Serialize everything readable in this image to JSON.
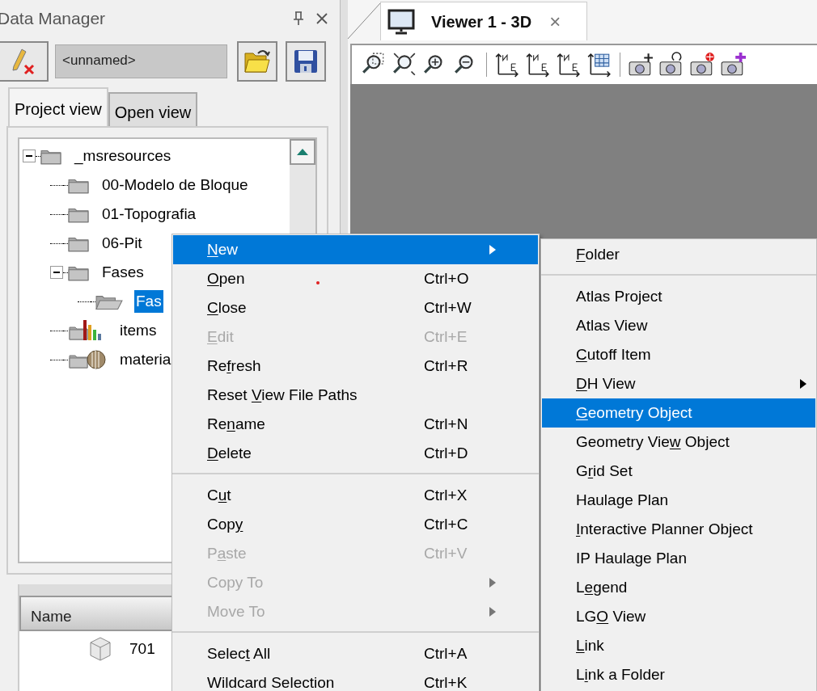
{
  "panel": {
    "title": "Data Manager",
    "project_field": {
      "value": "<unnamed>"
    },
    "tabs": [
      {
        "label": "Project view",
        "selected": true
      },
      {
        "label": "Open view",
        "selected": false
      }
    ],
    "tree": [
      {
        "label": "_msresources",
        "kind": "folder",
        "expanded": true,
        "selected": false,
        "children": [
          {
            "label": "00-Modelo de Bloque",
            "kind": "folder",
            "selected": false
          },
          {
            "label": "01-Topografia",
            "kind": "folder",
            "selected": false
          },
          {
            "label": "06-Pit",
            "kind": "folder",
            "selected": false
          },
          {
            "label": "Fases",
            "kind": "folder",
            "expanded": true,
            "selected": false,
            "children": [
              {
                "label": "Fas",
                "kind": "open",
                "selected": true
              }
            ]
          },
          {
            "label": "items",
            "kind": "chart",
            "selected": false
          },
          {
            "label": "materia",
            "kind": "material",
            "selected": false
          }
        ]
      }
    ],
    "list": {
      "columns": [
        "Name"
      ],
      "rows": [
        {
          "name": "701"
        }
      ]
    }
  },
  "viewer": {
    "tab": {
      "label": "Viewer 1 - 3D",
      "close": "×"
    }
  },
  "context_menu": {
    "groups": [
      [
        {
          "parts": [
            {
              "text": "N",
              "underline": true
            },
            {
              "text": "ew",
              "underline": false
            }
          ],
          "submenu": true,
          "disabled": false,
          "selected": true
        },
        {
          "parts": [
            {
              "text": "O",
              "underline": true
            },
            {
              "text": "pen",
              "underline": false
            }
          ],
          "shortcut": "Ctrl+O",
          "submenu": false,
          "disabled": false,
          "selected": false
        },
        {
          "parts": [
            {
              "text": "C",
              "underline": true
            },
            {
              "text": "lose",
              "underline": false
            }
          ],
          "shortcut": "Ctrl+W",
          "submenu": false,
          "disabled": false,
          "selected": false
        },
        {
          "parts": [
            {
              "text": "E",
              "underline": true
            },
            {
              "text": "dit",
              "underline": false
            }
          ],
          "shortcut": "Ctrl+E",
          "submenu": false,
          "disabled": true,
          "selected": false
        },
        {
          "parts": [
            {
              "text": "Re",
              "underline": false
            },
            {
              "text": "f",
              "underline": true
            },
            {
              "text": "resh",
              "underline": false
            }
          ],
          "shortcut": "Ctrl+R",
          "submenu": false,
          "disabled": false,
          "selected": false
        },
        {
          "parts": [
            {
              "text": "Reset ",
              "underline": false
            },
            {
              "text": "V",
              "underline": true
            },
            {
              "text": "iew File Paths",
              "underline": false
            }
          ],
          "submenu": false,
          "disabled": false,
          "selected": false
        },
        {
          "parts": [
            {
              "text": "Re",
              "underline": false
            },
            {
              "text": "n",
              "underline": true
            },
            {
              "text": "ame",
              "underline": false
            }
          ],
          "shortcut": "Ctrl+N",
          "submenu": false,
          "disabled": false,
          "selected": false
        },
        {
          "parts": [
            {
              "text": "D",
              "underline": true
            },
            {
              "text": "elete",
              "underline": false
            }
          ],
          "shortcut": "Ctrl+D",
          "submenu": false,
          "disabled": false,
          "selected": false
        }
      ],
      [
        {
          "parts": [
            {
              "text": "C",
              "underline": false
            },
            {
              "text": "u",
              "underline": true
            },
            {
              "text": "t",
              "underline": false
            }
          ],
          "shortcut": "Ctrl+X",
          "submenu": false,
          "disabled": false,
          "selected": false
        },
        {
          "parts": [
            {
              "text": "Cop",
              "underline": false
            },
            {
              "text": "y",
              "underline": true
            }
          ],
          "shortcut": "Ctrl+C",
          "submenu": false,
          "disabled": false,
          "selected": false
        },
        {
          "parts": [
            {
              "text": "P",
              "underline": false
            },
            {
              "text": "a",
              "underline": true
            },
            {
              "text": "ste",
              "underline": false
            }
          ],
          "shortcut": "Ctrl+V",
          "submenu": false,
          "disabled": true,
          "selected": false
        },
        {
          "parts": [
            {
              "text": "Copy To",
              "underline": false
            }
          ],
          "submenu": true,
          "disabled": true,
          "selected": false
        },
        {
          "parts": [
            {
              "text": "Move To",
              "underline": false
            }
          ],
          "submenu": true,
          "disabled": true,
          "selected": false
        }
      ],
      [
        {
          "parts": [
            {
              "text": "Selec",
              "underline": false
            },
            {
              "text": "t",
              "underline": true
            },
            {
              "text": " All",
              "underline": false
            }
          ],
          "shortcut": "Ctrl+A",
          "submenu": false,
          "disabled": false,
          "selected": false
        },
        {
          "parts": [
            {
              "text": "Wildcard Selection",
              "underline": false
            }
          ],
          "shortcut": "Ctrl+K",
          "submenu": false,
          "disabled": false,
          "selected": false
        }
      ]
    ]
  },
  "submenu": {
    "groups": [
      [
        {
          "parts": [
            {
              "text": "F",
              "underline": true
            },
            {
              "text": "older",
              "underline": false
            }
          ],
          "submenu": false,
          "disabled": false,
          "selected": false
        }
      ],
      [
        {
          "parts": [
            {
              "text": "Atlas Project",
              "underline": false
            }
          ],
          "submenu": false,
          "disabled": false,
          "selected": false
        },
        {
          "parts": [
            {
              "text": "Atlas View",
              "underline": false
            }
          ],
          "submenu": false,
          "disabled": false,
          "selected": false
        },
        {
          "parts": [
            {
              "text": "C",
              "underline": true
            },
            {
              "text": "utoff Item",
              "underline": false
            }
          ],
          "submenu": false,
          "disabled": false,
          "selected": false
        },
        {
          "parts": [
            {
              "text": "D",
              "underline": true
            },
            {
              "text": "H View",
              "underline": false
            }
          ],
          "submenu": true,
          "disabled": false,
          "selected": false
        },
        {
          "parts": [
            {
              "text": "G",
              "underline": true
            },
            {
              "text": "eometry Object",
              "underline": false
            }
          ],
          "submenu": false,
          "disabled": false,
          "selected": true
        },
        {
          "parts": [
            {
              "text": "Geometry Vie",
              "underline": false
            },
            {
              "text": "w",
              "underline": true
            },
            {
              "text": " Object",
              "underline": false
            }
          ],
          "submenu": false,
          "disabled": false,
          "selected": false
        },
        {
          "parts": [
            {
              "text": "G",
              "underline": false
            },
            {
              "text": "r",
              "underline": true
            },
            {
              "text": "id Set",
              "underline": false
            }
          ],
          "submenu": false,
          "disabled": false,
          "selected": false
        },
        {
          "parts": [
            {
              "text": "Haulage Plan",
              "underline": false
            }
          ],
          "submenu": false,
          "disabled": false,
          "selected": false
        },
        {
          "parts": [
            {
              "text": "I",
              "underline": true
            },
            {
              "text": "nteractive Planner Object",
              "underline": false
            }
          ],
          "submenu": false,
          "disabled": false,
          "selected": false
        },
        {
          "parts": [
            {
              "text": "IP Haulage Plan",
              "underline": false
            }
          ],
          "submenu": false,
          "disabled": false,
          "selected": false
        },
        {
          "parts": [
            {
              "text": "L",
              "underline": false
            },
            {
              "text": "e",
              "underline": true
            },
            {
              "text": "gend",
              "underline": false
            }
          ],
          "submenu": false,
          "disabled": false,
          "selected": false
        },
        {
          "parts": [
            {
              "text": "LG",
              "underline": false
            },
            {
              "text": "O",
              "underline": true
            },
            {
              "text": " View",
              "underline": false
            }
          ],
          "submenu": false,
          "disabled": false,
          "selected": false
        },
        {
          "parts": [
            {
              "text": "L",
              "underline": true
            },
            {
              "text": "ink",
              "underline": false
            }
          ],
          "submenu": false,
          "disabled": false,
          "selected": false
        },
        {
          "parts": [
            {
              "text": "L",
              "underline": false
            },
            {
              "text": "i",
              "underline": true
            },
            {
              "text": "nk a Folder",
              "underline": false
            }
          ],
          "submenu": false,
          "disabled": false,
          "selected": false
        }
      ]
    ]
  }
}
